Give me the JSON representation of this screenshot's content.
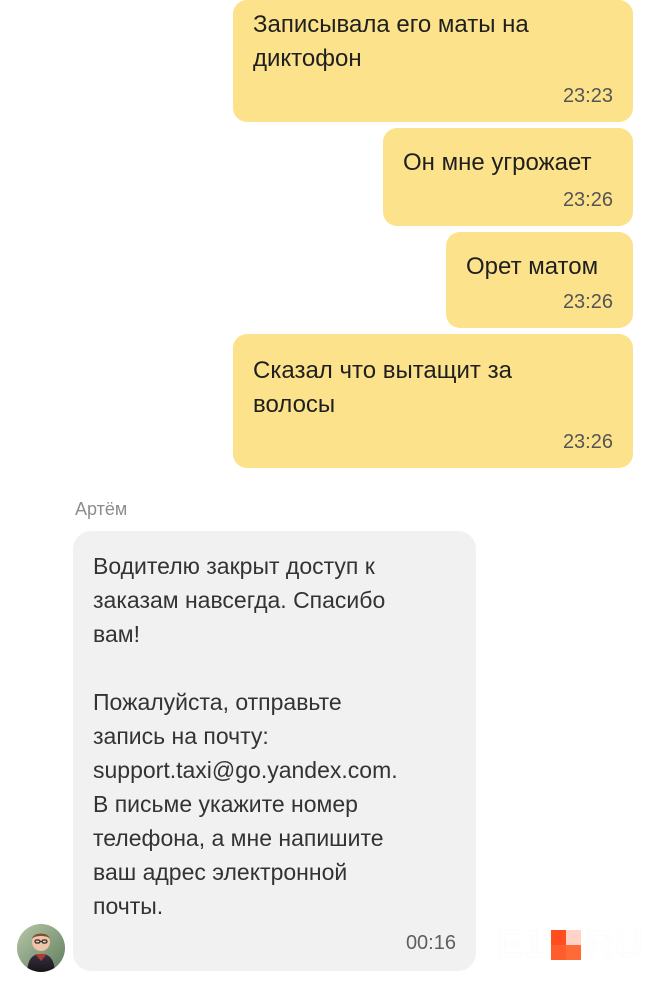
{
  "messages": {
    "outgoing": [
      {
        "text": "Записывала его маты на\nдиктофон",
        "time": "23:23"
      },
      {
        "text": "Он мне угрожает",
        "time": "23:26"
      },
      {
        "text": "Орет матом",
        "time": "23:26"
      },
      {
        "text": "Сказал что вытащит за\nволосы",
        "time": "23:26"
      }
    ],
    "incoming": {
      "sender": "Артём",
      "text": "Водителю закрыт доступ к\nзаказам навсегда. Спасибо\nвам!\n\nПожалуйста, отправьте\nзапись на почту:\nsupport.taxi@go.yandex.com.\nВ письме укажите номер\nтелефона, а мне напишите\nваш адрес электронной\nпочты.",
      "time": "00:16"
    }
  },
  "avatar": {
    "icon": "user-avatar-icon"
  },
  "watermark": {
    "left": "E1",
    "right": "RU",
    "colors": {
      "text": "#ffffff",
      "accent_1": "#ff4d1d",
      "accent_2": "#ffd3c7",
      "accent_3": "#ff5d2d",
      "accent_4": "#ff6a37"
    }
  },
  "colors": {
    "outgoing_bubble": "#fce38b",
    "incoming_bubble": "#f1f1f1",
    "sender_name": "#8d8d8d",
    "timestamp": "#555555"
  }
}
